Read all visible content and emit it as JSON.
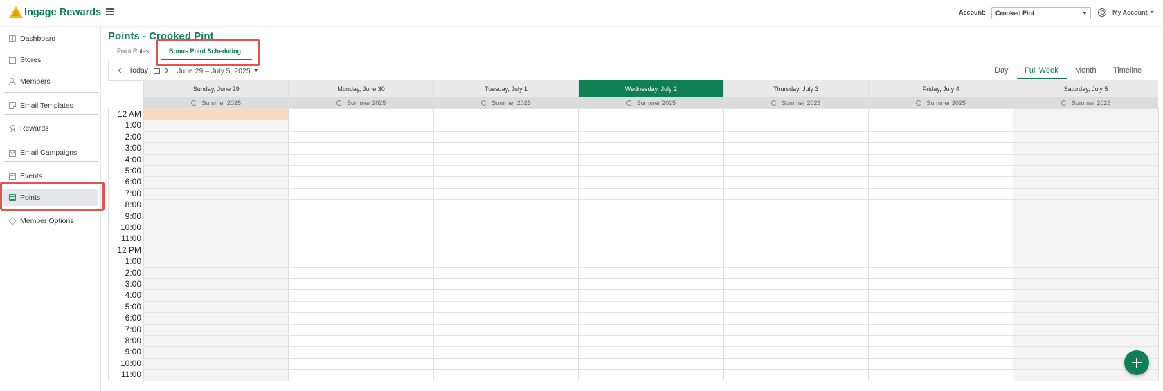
{
  "header": {
    "logo_text": "Ingage Rewards",
    "account_label": "Account:",
    "account_value": "Crooked Pint",
    "my_account": "My Account"
  },
  "sidebar": {
    "items": [
      {
        "label": "Dashboard",
        "icon": "dashboard-icon"
      },
      {
        "label": "Stores",
        "icon": "store-icon"
      },
      {
        "label": "Members",
        "icon": "members-icon"
      },
      {
        "label": "Email Templates",
        "icon": "template-icon"
      },
      {
        "label": "Rewards",
        "icon": "reward-icon"
      },
      {
        "label": "Email Campaigns",
        "icon": "mail-icon"
      },
      {
        "label": "Events",
        "icon": "calendar-icon"
      },
      {
        "label": "Points",
        "icon": "points-icon",
        "active": true
      },
      {
        "label": "Member Options",
        "icon": "cube-icon"
      }
    ]
  },
  "main": {
    "title": "Points - Crooked Pint",
    "tabs": [
      {
        "label": "Point Rules"
      },
      {
        "label": "Bonus Point Scheduling",
        "active": true
      }
    ]
  },
  "calendar": {
    "today_label": "Today",
    "date_range": "June 29 – July 5, 2025",
    "views": [
      "Day",
      "Full Week",
      "Month",
      "Timeline"
    ],
    "active_view": "Full Week",
    "days": [
      {
        "label": "Sunday, June 29",
        "schedule": "Summer 2025"
      },
      {
        "label": "Monday, June 30",
        "schedule": "Summer 2025"
      },
      {
        "label": "Tuesday, July 1",
        "schedule": "Summer 2025"
      },
      {
        "label": "Wednesday, July 2",
        "schedule": "Summer 2025",
        "today": true
      },
      {
        "label": "Thursday, July 3",
        "schedule": "Summer 2025"
      },
      {
        "label": "Friday, July 4",
        "schedule": "Summer 2025"
      },
      {
        "label": "Saturday, July 5",
        "schedule": "Summer 2025"
      }
    ],
    "hours": [
      "12 AM",
      "1:00",
      "2:00",
      "3:00",
      "4:00",
      "5:00",
      "6:00",
      "7:00",
      "8:00",
      "9:00",
      "10:00",
      "11:00",
      "12 PM",
      "1:00",
      "2:00",
      "3:00",
      "4:00",
      "5:00",
      "6:00",
      "7:00",
      "8:00",
      "9:00",
      "10:00",
      "11:00"
    ]
  },
  "colors": {
    "brand": "#0f7f55",
    "highlight": "#e4534b",
    "selected_slot": "#f9d9c0"
  }
}
